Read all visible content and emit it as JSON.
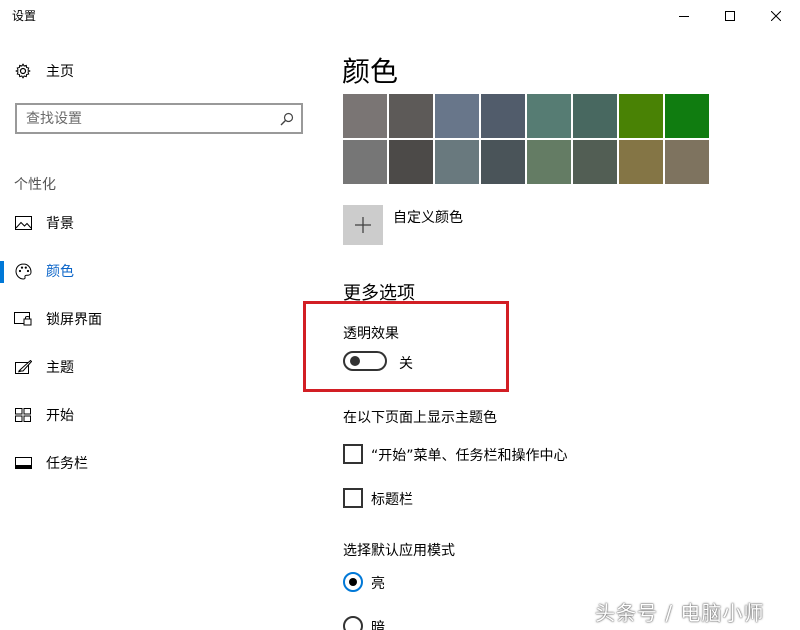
{
  "window": {
    "title": "设置"
  },
  "sidebar": {
    "home_label": "主页",
    "search_placeholder": "查找设置",
    "section_label": "个性化",
    "items": [
      {
        "label": "背景",
        "icon": "picture-icon"
      },
      {
        "label": "颜色",
        "icon": "palette-icon",
        "active": true
      },
      {
        "label": "锁屏界面",
        "icon": "lock-screen-icon"
      },
      {
        "label": "主题",
        "icon": "brush-icon"
      },
      {
        "label": "开始",
        "icon": "start-grid-icon"
      },
      {
        "label": "任务栏",
        "icon": "taskbar-icon"
      }
    ]
  },
  "main": {
    "title": "颜色",
    "swatch_colors": [
      "#7a7574",
      "#5d5a58",
      "#68768a",
      "#515c6b",
      "#567c73",
      "#486860",
      "#498205",
      "#107c10",
      "#767676",
      "#4c4a48",
      "#69797e",
      "#4a5459",
      "#647c64",
      "#525e54",
      "#847545",
      "#7e735f"
    ],
    "custom_color_label": "自定义颜色",
    "more_options_heading": "更多选项",
    "transparency": {
      "label": "透明效果",
      "state": "关"
    },
    "accent_surfaces": {
      "heading": "在以下页面上显示主题色",
      "options": [
        {
          "label": "“开始”菜单、任务栏和操作中心",
          "checked": false
        },
        {
          "label": "标题栏",
          "checked": false
        }
      ]
    },
    "app_mode": {
      "heading": "选择默认应用模式",
      "options": [
        {
          "label": "亮",
          "selected": true
        },
        {
          "label": "暗",
          "selected": false
        }
      ]
    }
  },
  "watermark": "头条号 / 电脑小师",
  "colors": {
    "accent": "#0078d7",
    "highlight_border": "#d21e24"
  }
}
